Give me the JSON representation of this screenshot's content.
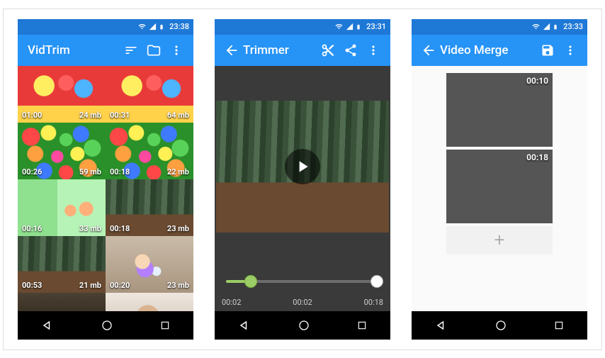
{
  "screens": {
    "list": {
      "status_time": "23:38",
      "app_title": "VidTrim",
      "videos": [
        {
          "duration": "01:00",
          "size": "24 mb",
          "theme": "playground"
        },
        {
          "duration": "00:31",
          "size": "64 mb",
          "theme": "playground"
        },
        {
          "duration": "00:26",
          "size": "59 mb",
          "theme": "ballpit"
        },
        {
          "duration": "00:18",
          "size": "22 mb",
          "theme": "ballpit"
        },
        {
          "duration": "00:16",
          "size": "33 mb",
          "theme": "greenroom"
        },
        {
          "duration": "00:18",
          "size": "23 mb",
          "theme": "forest"
        },
        {
          "duration": "00:53",
          "size": "21 mb",
          "theme": "forest"
        },
        {
          "duration": "00:20",
          "size": "23 mb",
          "theme": "kidphone"
        },
        {
          "duration": "",
          "size": "",
          "theme": "dark"
        },
        {
          "duration": "",
          "size": "",
          "theme": "face"
        }
      ]
    },
    "trimmer": {
      "status_time": "23:31",
      "app_title": "Trimmer",
      "timecodes": {
        "start": "00:02",
        "current": "00:02",
        "end": "00:18"
      }
    },
    "merge": {
      "status_time": "23:33",
      "app_title": "Video Merge",
      "clips": [
        {
          "duration": "00:10",
          "theme": "forest"
        },
        {
          "duration": "00:18",
          "theme": "forest"
        }
      ],
      "add_label": "+"
    }
  },
  "colors": {
    "primary": "#2693f7",
    "primary_dark": "#1e78d6",
    "start_handle": "#9ccc65"
  }
}
